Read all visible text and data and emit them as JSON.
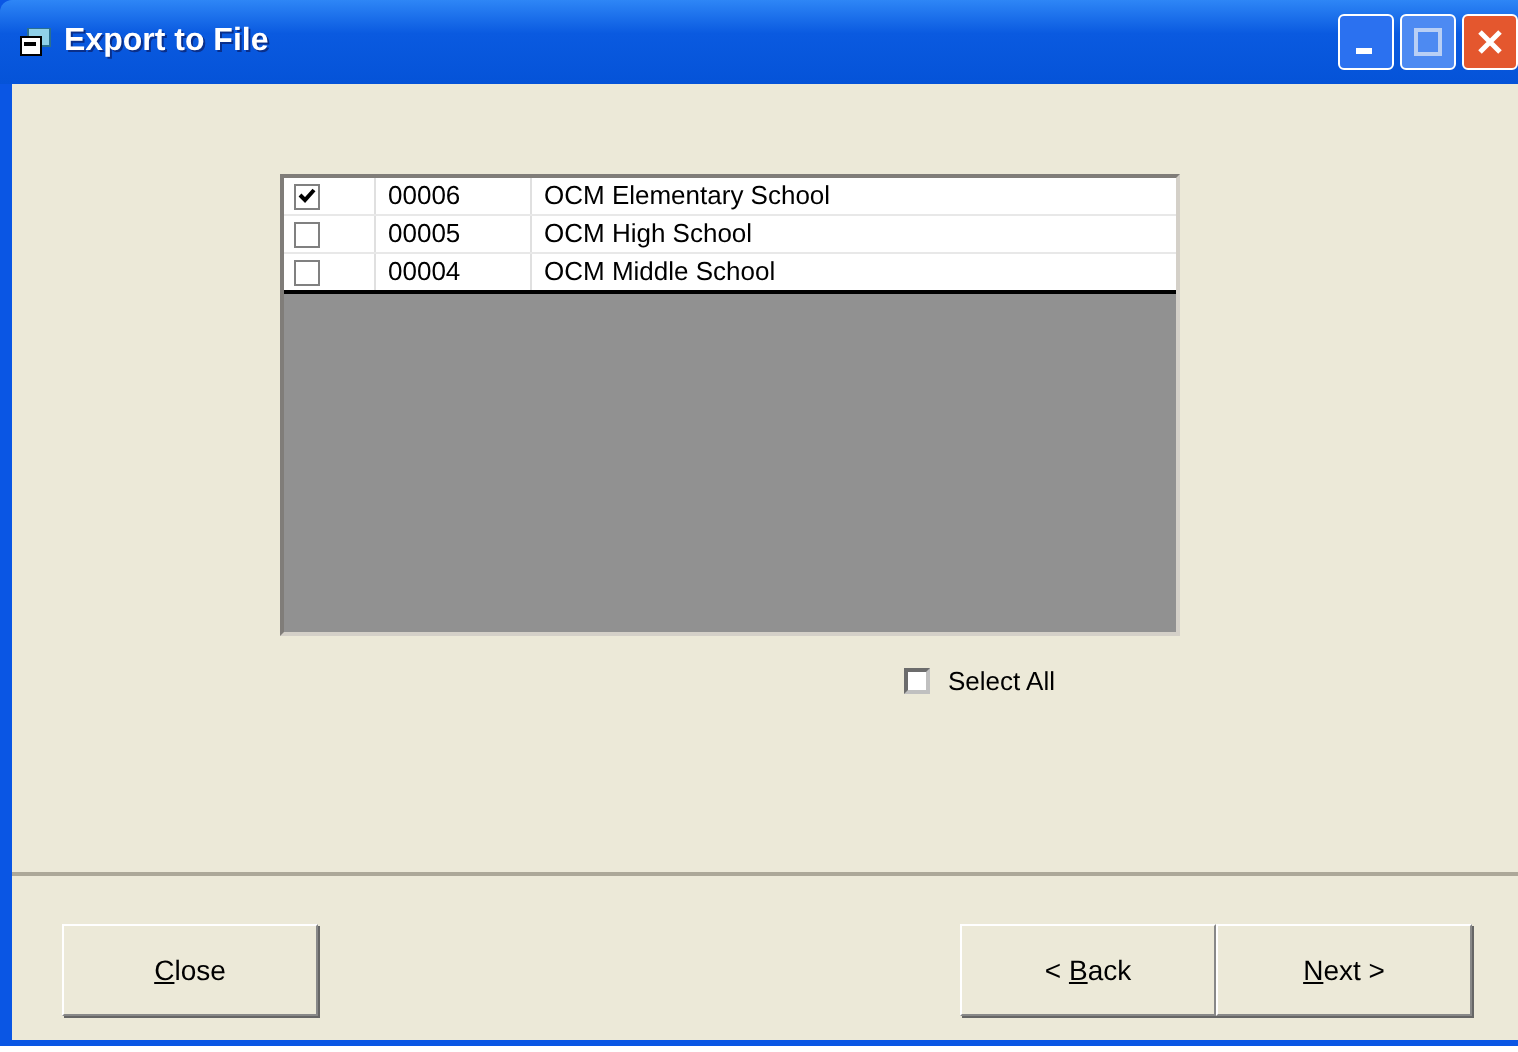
{
  "window": {
    "title": "Export to File"
  },
  "table": {
    "rows": [
      {
        "checked": true,
        "id": "00006",
        "name": "OCM Elementary School"
      },
      {
        "checked": false,
        "id": "00005",
        "name": "OCM High School"
      },
      {
        "checked": false,
        "id": "00004",
        "name": "OCM Middle School"
      }
    ]
  },
  "select_all": {
    "label": "Select All",
    "checked": false
  },
  "left_buttons": [
    {
      "key": "C",
      "after": "lose"
    }
  ],
  "right_buttons": [
    {
      "before": "< ",
      "key": "B",
      "after": "ack"
    },
    {
      "key": "N",
      "after": "ext >"
    }
  ]
}
